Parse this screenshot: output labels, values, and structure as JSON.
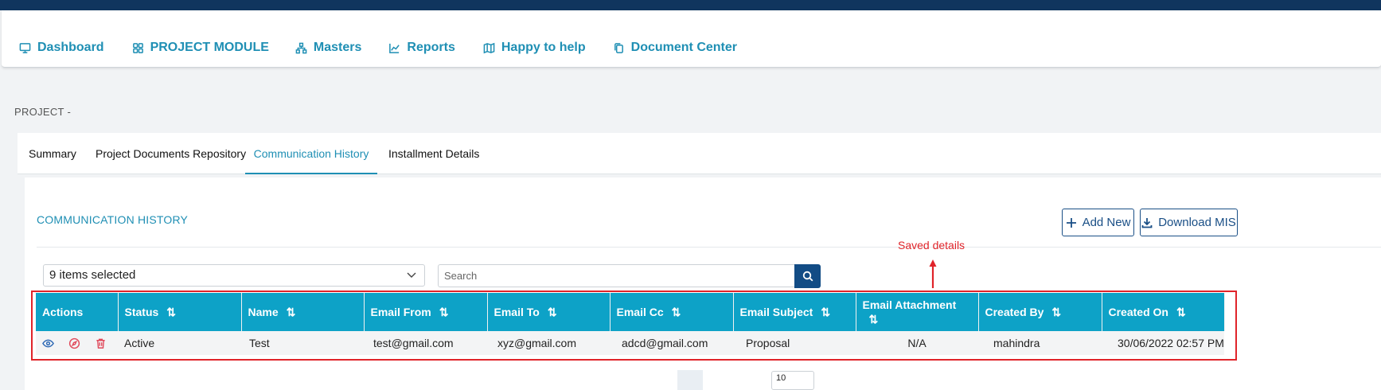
{
  "nav": {
    "items": [
      {
        "label": "Dashboard",
        "icon": "monitor-icon"
      },
      {
        "label": "PROJECT MODULE",
        "icon": "grid-icon"
      },
      {
        "label": "Masters",
        "icon": "hierarchy-icon"
      },
      {
        "label": "Reports",
        "icon": "line-chart-icon"
      },
      {
        "label": "Happy to help",
        "icon": "map-icon"
      },
      {
        "label": "Document Center",
        "icon": "copy-icon"
      }
    ]
  },
  "breadcrumb": "PROJECT -",
  "tabs": [
    "Summary",
    "Project Documents Repository",
    "Communication History",
    "Installment Details"
  ],
  "active_tab": "Communication History",
  "section": {
    "title": "COMMUNICATION HISTORY",
    "add_new": "Add New",
    "download_mis": "Download MIS"
  },
  "filters": {
    "selected_label": "9 items selected",
    "search_placeholder": "Search"
  },
  "annotation": "Saved details",
  "table": {
    "headers": [
      "Actions",
      "Status",
      "Name",
      "Email From",
      "Email To",
      "Email Cc",
      "Email Subject",
      "Email Attachment",
      "Created By",
      "Created On"
    ],
    "rows": [
      {
        "status": "Active",
        "name": "Test",
        "email_from": "test@gmail.com",
        "email_to": "xyz@gmail.com",
        "email_cc": "adcd@gmail.com",
        "subject": "Proposal",
        "attachment": "N/A",
        "created_by": "mahindra",
        "created_on": "30/06/2022 02:57 PM"
      }
    ]
  },
  "pagination": {
    "page_size": "10"
  },
  "colors": {
    "topbar": "#10355e",
    "accent": "#1f8fb4",
    "table_header": "#0da2c7",
    "primary_button": "#124c85",
    "annotation_red": "#e0242a",
    "eye_icon": "#2a66b3",
    "compass_icon": "#e0485a",
    "trash_icon": "#e0485a"
  }
}
